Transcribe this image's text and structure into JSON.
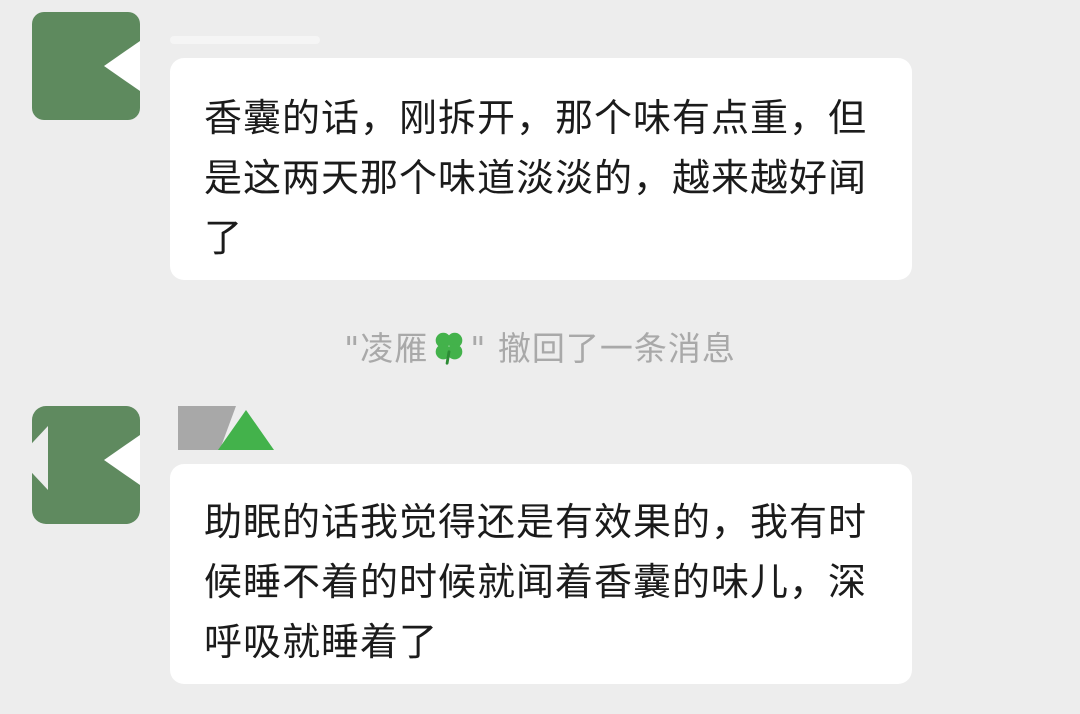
{
  "messages": [
    {
      "avatar": "blurred-green-avatar-icon",
      "text": "香囊的话，刚拆开，那个味有点重，但是这两天那个味道淡淡的，越来越好闻了"
    },
    {
      "avatar": "blurred-green-avatar-icon",
      "text": "助眠的话我觉得还是有效果的，我有时候睡不着的时候就闻着香囊的味儿，深呼吸就睡着了"
    }
  ],
  "system_note": {
    "prefix": "\"凌雁",
    "icon": "four-leaf-clover-icon",
    "suffix": "\" 撤回了一条消息"
  },
  "colors": {
    "background": "#ededed",
    "bubble": "#ffffff",
    "message_text": "#1b1b1b",
    "system_text": "#a9a9a9",
    "avatar_green": "#5e8a5e",
    "clover_green": "#43b24b"
  }
}
